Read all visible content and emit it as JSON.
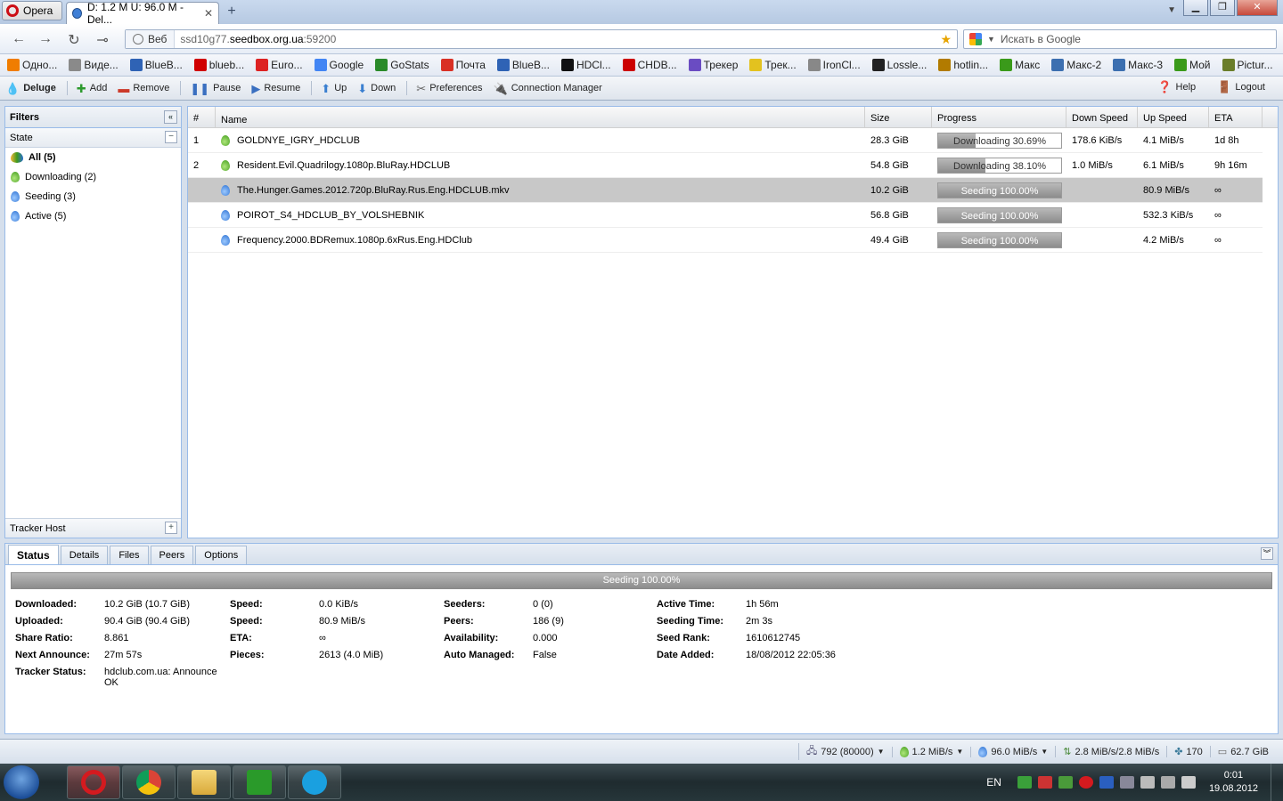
{
  "browser": {
    "menu_label": "Opera",
    "tab_title": "D: 1.2 M U: 96.0 M - Del...",
    "address": {
      "site_label": "Веб",
      "url_prefix": "ssd10g77.",
      "url_domain": "seedbox.org.ua",
      "url_suffix": ":59200"
    },
    "search_placeholder": "Искать в Google",
    "bookmarks": [
      {
        "label": "Одно...",
        "color": "#f07d00"
      },
      {
        "label": "Виде...",
        "color": "#8a8a8a"
      },
      {
        "label": "BlueB...",
        "color": "#2f63b5"
      },
      {
        "label": "blueb...",
        "color": "#d00000"
      },
      {
        "label": "Euro...",
        "color": "#d22"
      },
      {
        "label": "Google",
        "color": "#4285f4"
      },
      {
        "label": "GoStats",
        "color": "#2a8a2a"
      },
      {
        "label": "Почта",
        "color": "#d93025"
      },
      {
        "label": "BlueB...",
        "color": "#2f63b5"
      },
      {
        "label": "HDCl...",
        "color": "#111"
      },
      {
        "label": "CHDB...",
        "color": "#c00"
      },
      {
        "label": "Трекер",
        "color": "#6a4cc2"
      },
      {
        "label": "Трек...",
        "color": "#e3c21f"
      },
      {
        "label": "IronCl...",
        "color": "#888"
      },
      {
        "label": "Lossle...",
        "color": "#222"
      },
      {
        "label": "hotlin...",
        "color": "#b27b00"
      },
      {
        "label": "Макс",
        "color": "#3a9a1a"
      },
      {
        "label": "Макс-2",
        "color": "#3c6fb0"
      },
      {
        "label": "Макс-3",
        "color": "#3c6fb0"
      },
      {
        "label": "Мой",
        "color": "#3a9a1a"
      },
      {
        "label": "Pictur...",
        "color": "#6a7d2a"
      }
    ]
  },
  "toolbar": {
    "brand": "Deluge",
    "add": "Add",
    "remove": "Remove",
    "pause": "Pause",
    "resume": "Resume",
    "up": "Up",
    "down": "Down",
    "preferences": "Preferences",
    "connection_manager": "Connection Manager",
    "help": "Help",
    "logout": "Logout"
  },
  "filters": {
    "title": "Filters",
    "state_label": "State",
    "items": [
      {
        "label": "All (5)",
        "type": "all"
      },
      {
        "label": "Downloading (2)",
        "type": "downloading"
      },
      {
        "label": "Seeding (3)",
        "type": "seeding"
      },
      {
        "label": "Active (5)",
        "type": "active"
      }
    ],
    "tracker_host_label": "Tracker Host"
  },
  "grid": {
    "headers": {
      "num": "#",
      "name": "Name",
      "size": "Size",
      "progress": "Progress",
      "down": "Down Speed",
      "up": "Up Speed",
      "eta": "ETA"
    },
    "rows": [
      {
        "num": "1",
        "name": "GOLDNYE_IGRY_HDCLUB",
        "size": "28.3 GiB",
        "progress_label": "Downloading 30.69%",
        "progress": 30.69,
        "state": "downloading",
        "down": "178.6 KiB/s",
        "up": "4.1 MiB/s",
        "eta": "1d 8h"
      },
      {
        "num": "2",
        "name": "Resident.Evil.Quadrilogy.1080p.BluRay.HDCLUB",
        "size": "54.8 GiB",
        "progress_label": "Downloading 38.10%",
        "progress": 38.1,
        "state": "downloading",
        "down": "1.0 MiB/s",
        "up": "6.1 MiB/s",
        "eta": "9h 16m"
      },
      {
        "num": "",
        "name": "The.Hunger.Games.2012.720p.BluRay.Rus.Eng.HDCLUB.mkv",
        "size": "10.2 GiB",
        "progress_label": "Seeding 100.00%",
        "progress": 100,
        "state": "seeding",
        "down": "",
        "up": "80.9 MiB/s",
        "eta": "∞"
      },
      {
        "num": "",
        "name": "POIROT_S4_HDCLUB_BY_VOLSHEBNIK",
        "size": "56.8 GiB",
        "progress_label": "Seeding 100.00%",
        "progress": 100,
        "state": "seeding",
        "down": "",
        "up": "532.3 KiB/s",
        "eta": "∞"
      },
      {
        "num": "",
        "name": "Frequency.2000.BDRemux.1080p.6xRus.Eng.HDClub",
        "size": "49.4 GiB",
        "progress_label": "Seeding 100.00%",
        "progress": 100,
        "state": "seeding",
        "down": "",
        "up": "4.2 MiB/s",
        "eta": "∞"
      }
    ]
  },
  "details": {
    "tabs": [
      "Status",
      "Details",
      "Files",
      "Peers",
      "Options"
    ],
    "progress_label": "Seeding 100.00%",
    "col1": [
      {
        "k": "Downloaded:",
        "v": "10.2 GiB (10.7 GiB)"
      },
      {
        "k": "Uploaded:",
        "v": "90.4 GiB (90.4 GiB)"
      },
      {
        "k": "Share Ratio:",
        "v": "8.861"
      },
      {
        "k": "Next Announce:",
        "v": "27m 57s"
      },
      {
        "k": "Tracker Status:",
        "v": "hdclub.com.ua: Announce OK"
      }
    ],
    "col2": [
      {
        "k": "Speed:",
        "v": "0.0 KiB/s"
      },
      {
        "k": "Speed:",
        "v": "80.9 MiB/s"
      },
      {
        "k": "ETA:",
        "v": "∞"
      },
      {
        "k": "Pieces:",
        "v": "2613 (4.0 MiB)"
      }
    ],
    "col3": [
      {
        "k": "Seeders:",
        "v": "0 (0)"
      },
      {
        "k": "Peers:",
        "v": "186 (9)"
      },
      {
        "k": "Availability:",
        "v": "0.000"
      },
      {
        "k": "Auto Managed:",
        "v": "False"
      }
    ],
    "col4": [
      {
        "k": "Active Time:",
        "v": "1h 56m"
      },
      {
        "k": "Seeding Time:",
        "v": "2m 3s"
      },
      {
        "k": "Seed Rank:",
        "v": "1610612745"
      },
      {
        "k": "Date Added:",
        "v": "18/08/2012 22:05:36"
      }
    ]
  },
  "statusbar": {
    "connections": "792 (80000)",
    "download": "1.2 MiB/s",
    "upload": "96.0 MiB/s",
    "protocol": "2.8 MiB/s/2.8 MiB/s",
    "dht": "170",
    "free_space": "62.7 GiB"
  },
  "taskbar": {
    "lang": "EN",
    "time": "0:01",
    "date": "19.08.2012"
  }
}
